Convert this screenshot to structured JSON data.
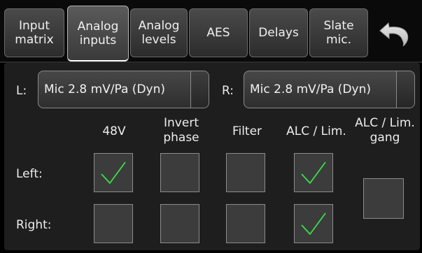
{
  "tabs": [
    {
      "label": "Input\nmatrix",
      "active": false
    },
    {
      "label": "Analog\ninputs",
      "active": true
    },
    {
      "label": "Analog\nlevels",
      "active": false
    },
    {
      "label": "AES",
      "active": false
    },
    {
      "label": "Delays",
      "active": false
    },
    {
      "label": "Slate\nmic.",
      "active": false
    }
  ],
  "back_icon": "undo-arrow-icon",
  "left_channel": {
    "label": "L:",
    "selected": "Mic 2.8 mV/Pa (Dyn)"
  },
  "right_channel": {
    "label": "R:",
    "selected": "Mic 2.8 mV/Pa (Dyn)"
  },
  "columns": [
    "48V",
    "Invert\nphase",
    "Filter",
    "ALC / Lim.",
    "ALC / Lim.\ngang"
  ],
  "rows": [
    "Left:",
    "Right:"
  ],
  "checkboxes": {
    "left": {
      "phantom_48v": true,
      "invert_phase": false,
      "filter": false,
      "alc_lim": true
    },
    "right": {
      "phantom_48v": false,
      "invert_phase": false,
      "filter": false,
      "alc_lim": true
    },
    "alc_lim_gang": false
  },
  "colors": {
    "check": "#3adf4a",
    "background": "#1e1e1e",
    "tab_bar": "#0a0a0a"
  }
}
